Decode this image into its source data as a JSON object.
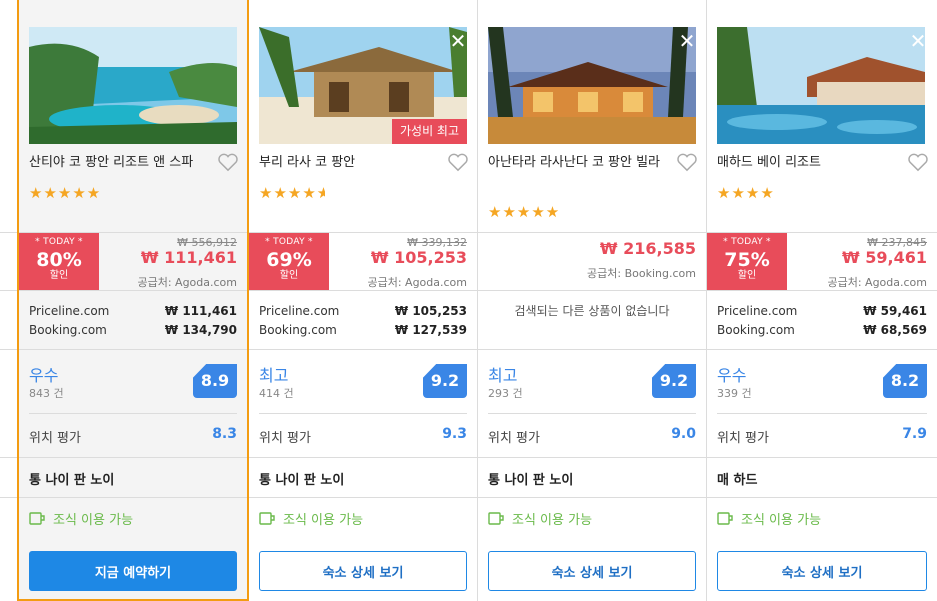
{
  "colors": {
    "accent": "#1e88e5",
    "discount": "#e84c5a",
    "rating": "#3a86e6",
    "breakfast": "#6aba4a",
    "highlight": "#f39c12",
    "star": "#f5a623"
  },
  "hotels": [
    {
      "name": "산티야 코 팡안 리조트 앤 스파",
      "stars": "★★★★★",
      "today": "* TODAY *",
      "discount_pct": "80%",
      "discount_label": "할인",
      "original_price": "₩ 556,912",
      "price": "₩ 111,461",
      "supplier": "공급처: Agoda.com",
      "others": [
        {
          "site": "Priceline.com",
          "price": "₩ 111,461"
        },
        {
          "site": "Booking.com",
          "price": "₩ 134,790"
        }
      ],
      "rating_text": "우수",
      "review_count": "843 건",
      "score": "8.9",
      "location_label": "위치 평가",
      "location_score": "8.3",
      "area": "통 나이 판 노이",
      "breakfast": "조식 이용 가능",
      "button": "지금 예약하기",
      "image": "resort-pool-ocean"
    },
    {
      "name": "부리 라사 코 팡안",
      "stars": "★★★★",
      "half_star": "★",
      "badge": "가성비 최고",
      "today": "* TODAY *",
      "discount_pct": "69%",
      "discount_label": "할인",
      "original_price": "₩ 339,132",
      "price": "₩ 105,253",
      "supplier": "공급처: Agoda.com",
      "others": [
        {
          "site": "Priceline.com",
          "price": "₩ 105,253"
        },
        {
          "site": "Booking.com",
          "price": "₩ 127,539"
        }
      ],
      "rating_text": "최고",
      "review_count": "414 건",
      "score": "9.2",
      "location_label": "위치 평가",
      "location_score": "9.3",
      "area": "통 나이 판 노이",
      "breakfast": "조식 이용 가능",
      "button": "숙소 상세 보기",
      "image": "beach-hut-palms"
    },
    {
      "name": "아난타라 라사난다 코 팡안 빌라",
      "stars": "★★★★★",
      "price": "₩ 216,585",
      "supplier": "공급처: Booking.com",
      "no_results": "검색되는 다른 상품이 없습니다",
      "rating_text": "최고",
      "review_count": "293 건",
      "score": "9.2",
      "location_label": "위치 평가",
      "location_score": "9.0",
      "area": "통 나이 판 노이",
      "breakfast": "조식 이용 가능",
      "button": "숙소 상세 보기",
      "image": "villa-night-pool"
    },
    {
      "name": "매하드 베이 리조트",
      "stars": "★★★★",
      "today": "* TODAY *",
      "discount_pct": "75%",
      "discount_label": "할인",
      "original_price": "₩ 237,845",
      "price": "₩ 59,461",
      "supplier": "공급처: Agoda.com",
      "others": [
        {
          "site": "Priceline.com",
          "price": "₩ 59,461"
        },
        {
          "site": "Booking.com",
          "price": "₩ 68,569"
        }
      ],
      "rating_text": "우수",
      "review_count": "339 건",
      "score": "8.2",
      "location_label": "위치 평가",
      "location_score": "7.9",
      "area": "매 하드",
      "breakfast": "조식 이용 가능",
      "button": "숙소 상세 보기",
      "image": "resort-pool-cabanas"
    }
  ]
}
